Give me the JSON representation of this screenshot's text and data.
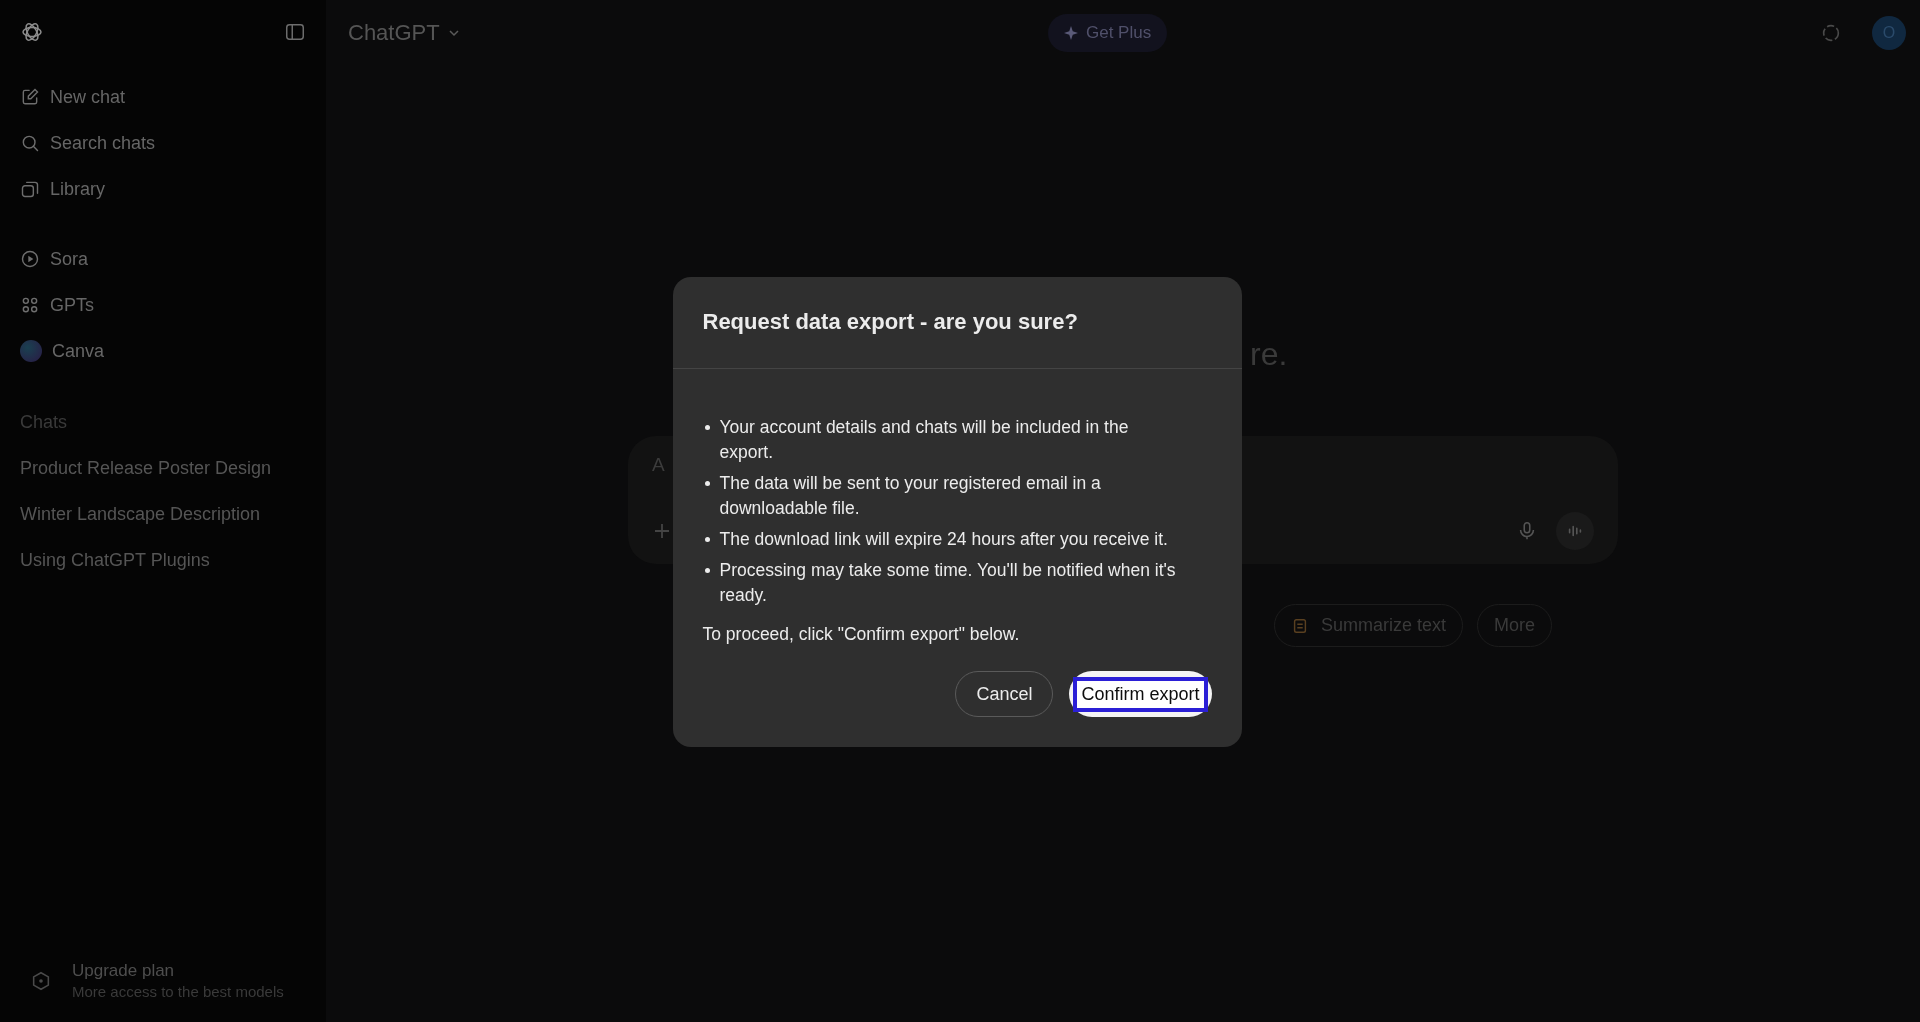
{
  "sidebar": {
    "nav": [
      {
        "label": "New chat",
        "kind": "edit"
      },
      {
        "label": "Search chats",
        "kind": "search"
      },
      {
        "label": "Library",
        "kind": "library"
      }
    ],
    "apps": [
      {
        "label": "Sora",
        "kind": "play"
      },
      {
        "label": "GPTs",
        "kind": "grid"
      },
      {
        "label": "Canva",
        "kind": "app"
      }
    ],
    "chats_heading": "Chats",
    "chats": [
      "Product Release Poster Design",
      "Winter Landscape Description",
      "Using ChatGPT Plugins"
    ],
    "upgrade": {
      "title": "Upgrade plan",
      "subtitle": "More access to the best models"
    }
  },
  "topbar": {
    "model": "ChatGPT",
    "get_plus": "Get Plus",
    "avatar": "O"
  },
  "main": {
    "heading_fragment": "re.",
    "input_placeholder": "A",
    "chips": [
      "Summarize text",
      "More"
    ]
  },
  "dialog": {
    "title": "Request data export - are you sure?",
    "bullets": [
      "Your account details and chats will be included in the export.",
      "The data will be sent to your registered email in a downloadable file.",
      "The download link will expire 24 hours after you receive it.",
      "Processing may take some time. You'll be notified when it's ready."
    ],
    "note": "To proceed, click \"Confirm export\" below.",
    "buttons": [
      {
        "label": "Cancel",
        "kind": "secondary",
        "focused": false
      },
      {
        "label": "Confirm export",
        "kind": "primary",
        "focused": true
      }
    ]
  }
}
